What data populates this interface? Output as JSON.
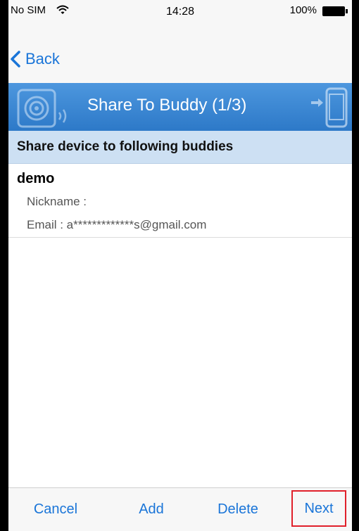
{
  "status_bar": {
    "carrier": "No SIM",
    "time": "14:28",
    "battery": "100%"
  },
  "nav": {
    "back_label": "Back"
  },
  "banner": {
    "title": "Share To Buddy (1/3)"
  },
  "section": {
    "header": "Share device to following buddies"
  },
  "buddies": [
    {
      "name": "demo",
      "nickname": "Nickname :",
      "email": "Email : a*************s@gmail.com"
    }
  ],
  "toolbar": {
    "cancel": "Cancel",
    "add": "Add",
    "delete": "Delete",
    "next": "Next"
  },
  "colors": {
    "accent": "#1a75d8",
    "banner_blue": "#3a87d4",
    "section_bg": "#cde0f3",
    "highlight_red": "#e0202a"
  }
}
